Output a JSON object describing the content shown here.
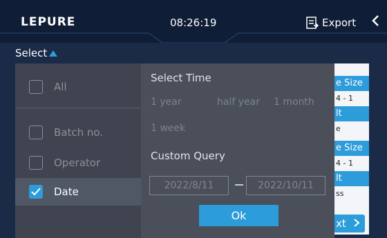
{
  "header": {
    "logo": "LEPURE",
    "time": "08:26:19",
    "export_label": "Export"
  },
  "select_toggle": "Select",
  "background": {
    "headers": [
      "e Size",
      "lt",
      "e Size",
      "lt"
    ],
    "cells": [
      "4 - 1",
      "e",
      "4 - 1",
      "ss"
    ],
    "next_label": "xt"
  },
  "dropdown": {
    "options": [
      {
        "label": "All",
        "checked": false
      },
      {
        "label": "Batch no.",
        "checked": false
      },
      {
        "label": "Operator",
        "checked": false
      },
      {
        "label": "Date",
        "checked": true
      }
    ],
    "select_time_title": "Select Time",
    "time_options": [
      "1 year",
      "half year",
      "1 month",
      "1 week"
    ],
    "custom_query_title": "Custom Query",
    "start_date": "2022/8/11",
    "end_date": "2022/10/11",
    "ok_label": "Ok"
  },
  "colors": {
    "accent": "#2d9cdb",
    "header_bg": "#0f1d36",
    "overlay_bg": "#4a4f59"
  }
}
